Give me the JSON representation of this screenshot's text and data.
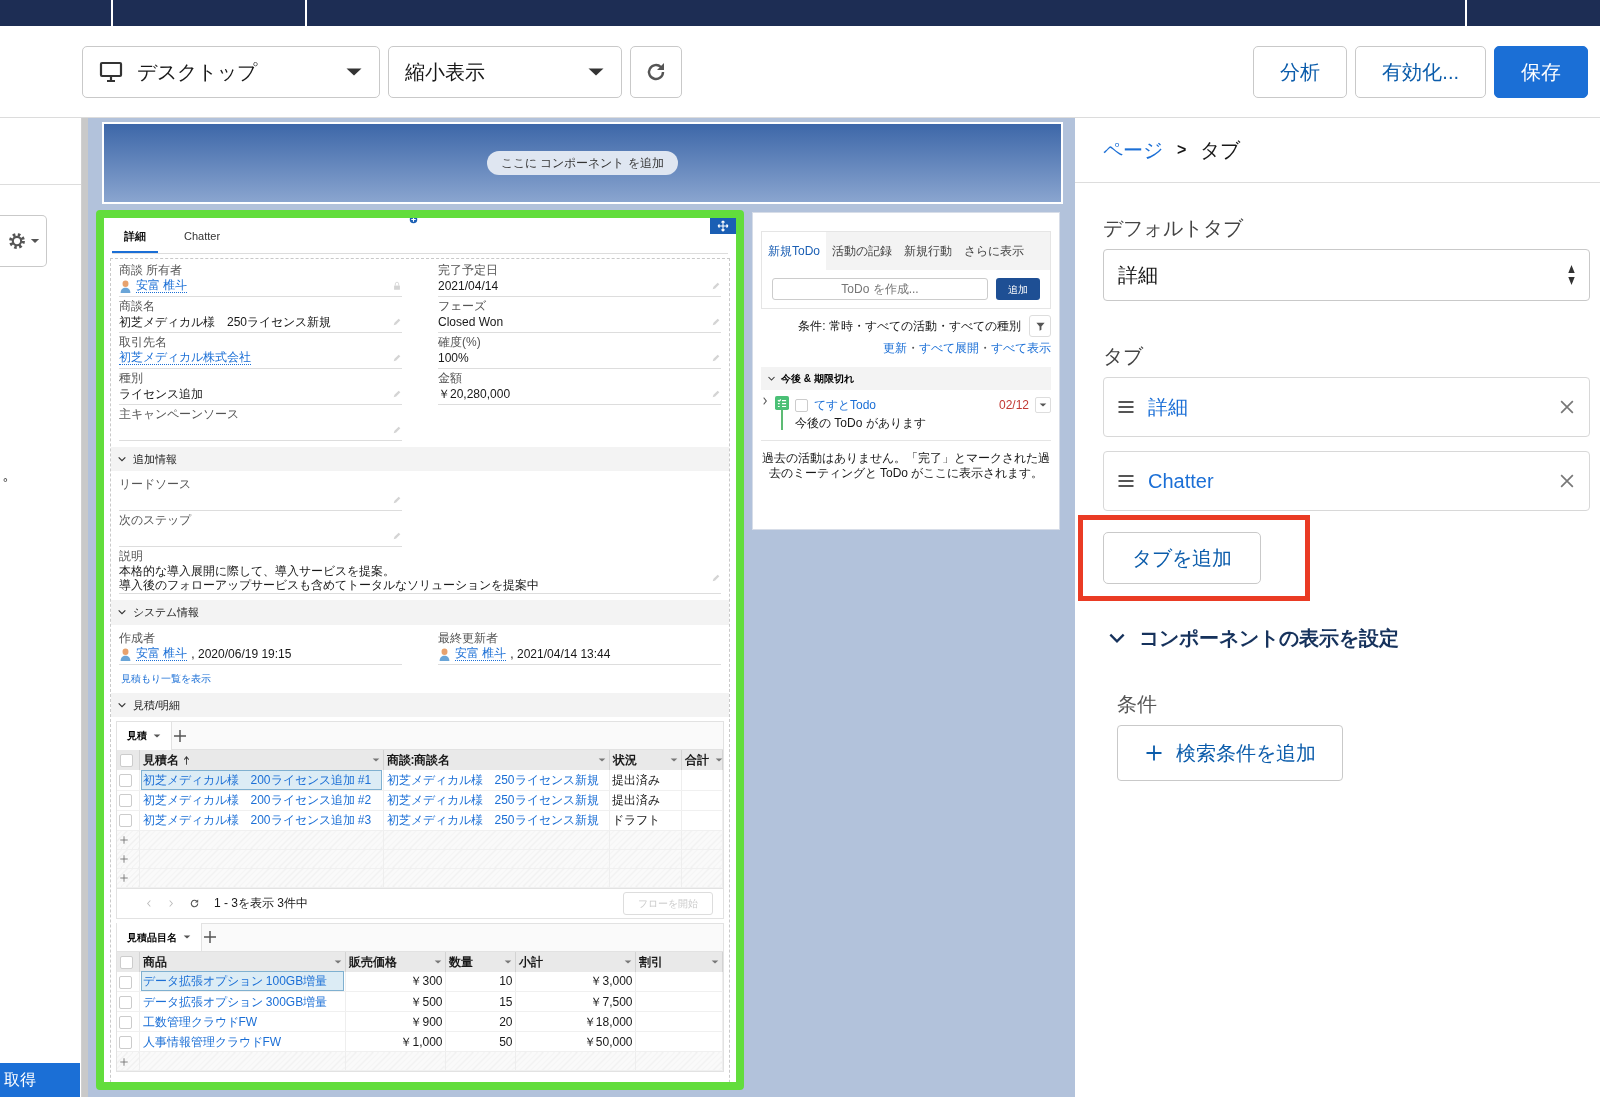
{
  "toolbar": {
    "device": "デスクトップ",
    "zoom": "縮小表示",
    "buttons": [
      {
        "label": "分析",
        "kind": "neutral"
      },
      {
        "label": "有効化...",
        "kind": "neutral"
      },
      {
        "label": "保存",
        "kind": "primary"
      }
    ]
  },
  "left_panel": {
    "note": "。",
    "button": "取得"
  },
  "canvas": {
    "header_placeholder": "ここに コンポーネント を追加",
    "record": {
      "tabs": [
        {
          "label": "詳細",
          "selected": true
        },
        {
          "label": "Chatter",
          "selected": false
        }
      ],
      "sections": [
        {
          "columns": [
            [
              {
                "label": "商談 所有者",
                "kind": "user",
                "value": "安富 椎斗",
                "editable": false,
                "locked": true
              },
              {
                "label": "商談名",
                "kind": "text",
                "value": "初芝メディカル様　250ライセンス新規",
                "editable": true,
                "locked": false
              },
              {
                "label": "取引先名",
                "kind": "link",
                "value": "初芝メディカル株式会社",
                "editable": true,
                "locked": false
              },
              {
                "label": "種別",
                "kind": "text",
                "value": "ライセンス追加",
                "editable": true,
                "locked": false
              },
              {
                "label": "主キャンペーンソース",
                "editable": true,
                "locked": false
              }
            ],
            [
              {
                "label": "完了予定日",
                "kind": "text",
                "value": "2021/04/14",
                "editable": true,
                "locked": false
              },
              {
                "label": "フェーズ",
                "kind": "text",
                "value": "Closed Won",
                "editable": true,
                "locked": false
              },
              {
                "label": "確度(%)",
                "kind": "text",
                "value": "100%",
                "editable": true,
                "locked": false
              },
              {
                "label": "金額",
                "kind": "text",
                "value": "￥20,280,000",
                "editable": true,
                "locked": false
              }
            ]
          ]
        },
        {
          "title": "追加情報",
          "expanded": true,
          "columns": [
            [
              {
                "label": "リードソース",
                "editable": true,
                "locked": false
              },
              {
                "label": "次のステップ",
                "editable": true,
                "locked": false
              }
            ],
            []
          ],
          "wide": [
            {
              "label": "説明",
              "kind": "lines",
              "lines": [
                "本格的な導入展開に際して、導入サービスを提案。",
                "導入後のフォローアップサービスも含めてトータルなソリューションを提案中"
              ],
              "editable": true,
              "locked": false
            }
          ]
        },
        {
          "title": "システム情報",
          "expanded": true,
          "columns": [
            [
              {
                "label": "作成者",
                "kind": "user",
                "value": "安富 椎斗",
                "suffix": ", 2020/06/19 19:15",
                "editable": false,
                "locked": false
              }
            ],
            [
              {
                "label": "最終更新者",
                "kind": "user",
                "value": "安富 椎斗",
                "suffix": ", 2021/04/14 13:44",
                "editable": false,
                "locked": false
              }
            ]
          ],
          "links": [
            "見積もり一覧を表示"
          ]
        },
        {
          "title": "見積/明細",
          "expanded": true,
          "grids": [
            {
              "tab": "見積",
              "all_checked": false,
              "columns": [
                {
                  "label": "見積名",
                  "kind": "link",
                  "sorted": true
                },
                {
                  "label": "商談:商談名",
                  "kind": "link",
                  "sorted": false
                },
                {
                  "label": "状況",
                  "kind": "text",
                  "sorted": false
                },
                {
                  "label": "合計",
                  "sorted": false
                }
              ],
              "rows": [
                {
                  "cells": [
                    "初芝メディカル様　200ライセンス追加 #1",
                    "初芝メディカル様　250ライセンス新規",
                    "提出済み"
                  ],
                  "checked": false,
                  "focused": true
                },
                {
                  "cells": [
                    "初芝メディカル様　200ライセンス追加 #2",
                    "初芝メディカル様　250ライセンス新規",
                    "提出済み"
                  ],
                  "checked": false,
                  "focused": false
                },
                {
                  "cells": [
                    "初芝メディカル様　200ライセンス追加 #3",
                    "初芝メディカル様　250ライセンス新規",
                    "ドラフト"
                  ],
                  "checked": false,
                  "focused": false
                }
              ],
              "footer": {
                "count": "1 - 3を表示 3件中",
                "button": "フローを開始",
                "disabled": true
              }
            },
            {
              "tab": "見積品目名",
              "all_checked": false,
              "columns": [
                {
                  "label": "商品",
                  "kind": "link",
                  "sorted": false
                },
                {
                  "label": "販売価格",
                  "kind": "number",
                  "sorted": false
                },
                {
                  "label": "数量",
                  "kind": "number",
                  "sorted": false
                },
                {
                  "label": "小計",
                  "kind": "number",
                  "sorted": false
                },
                {
                  "label": "割引",
                  "sorted": false
                }
              ],
              "rows": [
                {
                  "cells": [
                    "データ拡張オプション 100GB増量",
                    "￥300",
                    "10",
                    "￥3,000"
                  ],
                  "checked": false,
                  "focused": true
                },
                {
                  "cells": [
                    "データ拡張オプション 300GB増量",
                    "￥500",
                    "15",
                    "￥7,500"
                  ],
                  "checked": false,
                  "focused": false
                },
                {
                  "cells": [
                    "工数管理クラウドFW",
                    "￥900",
                    "20",
                    "￥18,000"
                  ],
                  "checked": false,
                  "focused": false
                },
                {
                  "cells": [
                    "人事情報管理クラウドFW",
                    "￥1,000",
                    "50",
                    "￥50,000"
                  ],
                  "checked": false,
                  "focused": false
                }
              ]
            }
          ]
        }
      ]
    },
    "activity": {
      "tabs": [
        {
          "label": "新規ToDo",
          "selected": true
        },
        {
          "label": "活動の記録",
          "selected": false
        },
        {
          "label": "新規行動",
          "selected": false
        },
        {
          "label": "さらに表示",
          "selected": false
        }
      ],
      "input_placeholder": "ToDo を作成...",
      "add_button": "追加",
      "filter": "条件: 常時・すべての活動・すべての種別",
      "links": [
        "更新",
        "すべて展開",
        "すべて表示"
      ],
      "link_separator": "・",
      "section": {
        "title": "今後 & 期限切れ",
        "expanded": true
      },
      "items": [
        {
          "title": "てすとTodo",
          "date": "02/12",
          "subtitle": "今後の ToDo があります",
          "checked": false,
          "overdue": true
        }
      ],
      "empty_message": "過去の活動はありません。「完了」とマークされた過去のミーティングと ToDo がここに表示されます。"
    }
  },
  "properties": {
    "breadcrumb": [
      {
        "label": "ページ",
        "kind": "link"
      },
      {
        "label": "タブ",
        "kind": "current"
      }
    ],
    "separator": ">",
    "default_tab_label": "デフォルトタブ",
    "default_tab_value": "詳細",
    "tabs_label": "タブ",
    "tabs": [
      "詳細",
      "Chatter"
    ],
    "add_tab": {
      "label": "タブを追加",
      "highlighted": true
    },
    "visibility": {
      "title": "コンポーネントの表示を設定",
      "expanded": true,
      "condition_label": "条件",
      "add_filter": "検索条件を追加"
    }
  }
}
